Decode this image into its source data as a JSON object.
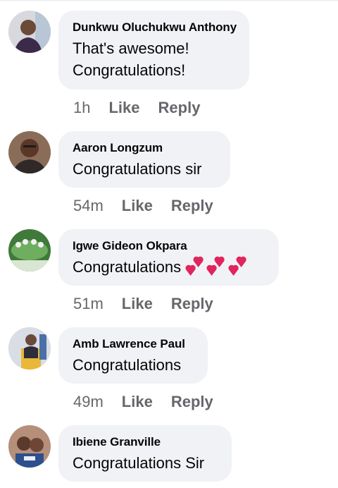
{
  "comments": [
    {
      "author": "Dunkwu Oluchukwu Anthony",
      "text_lines": [
        "That's awesome!",
        "Congratulations!"
      ],
      "time": "1h",
      "like_label": "Like",
      "reply_label": "Reply",
      "avatar_icon": "profile-photo"
    },
    {
      "author": "Aaron Longzum",
      "text_lines": [
        "Congratulations sir"
      ],
      "time": "54m",
      "like_label": "Like",
      "reply_label": "Reply",
      "avatar_icon": "profile-photo"
    },
    {
      "author": "Igwe Gideon Okpara",
      "text_lines": [
        "Congratulations"
      ],
      "emoji": "heart-emoji-group",
      "time": "51m",
      "like_label": "Like",
      "reply_label": "Reply",
      "avatar_icon": "profile-photo"
    },
    {
      "author": "Amb Lawrence Paul",
      "text_lines": [
        "Congratulations"
      ],
      "time": "49m",
      "like_label": "Like",
      "reply_label": "Reply",
      "avatar_icon": "profile-photo"
    },
    {
      "author": "Ibiene Granville",
      "text_lines": [
        "Congratulations Sir"
      ],
      "avatar_icon": "profile-photo"
    }
  ],
  "colors": {
    "bubble": "#f0f2f5",
    "text": "#050505",
    "meta": "#65676b",
    "heart": "#e0245e"
  }
}
